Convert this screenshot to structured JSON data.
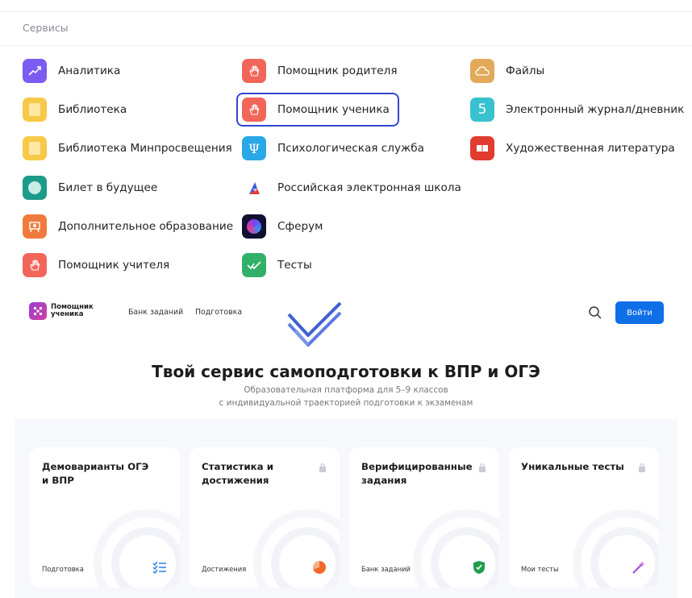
{
  "services": {
    "title": "Сервисы",
    "columns": [
      [
        {
          "label": "Аналитика",
          "icon": "analytics-icon",
          "color": "#7b5cf0"
        },
        {
          "label": "Библиотека",
          "icon": "book-icon",
          "color": "#f7c948"
        },
        {
          "label": "Библиотека Минпросвещения",
          "icon": "book-icon",
          "color": "#f7c948"
        },
        {
          "label": "Билет в будущее",
          "icon": "ticket-icon",
          "color": "#1d9b8a"
        },
        {
          "label": "Дополнительное образование",
          "icon": "teacher-icon",
          "color": "#f07a3d"
        },
        {
          "label": "Помощник учителя",
          "icon": "hand-icon",
          "color": "#f2665a"
        }
      ],
      [
        {
          "label": "Помощник родителя",
          "icon": "hand-icon",
          "color": "#f2665a"
        },
        {
          "label": "Помощник ученика",
          "icon": "hand-icon",
          "color": "#f2665a",
          "selected": true
        },
        {
          "label": "Психологическая служба",
          "icon": "psi-icon",
          "color": "#2aa7e6"
        },
        {
          "label": "Российская электронная школа",
          "icon": "res-logo-icon",
          "color": "#ffffff"
        },
        {
          "label": "Сферум",
          "icon": "sferum-icon",
          "color": "#101030"
        },
        {
          "label": "Тесты",
          "icon": "check-icon",
          "color": "#32b06a"
        }
      ],
      [
        {
          "label": "Файлы",
          "icon": "cloud-icon",
          "color": "#e3a95a"
        },
        {
          "label": "Электронный журнал/дневник",
          "icon": "five-icon",
          "color": "#39c1cf",
          "glyph": "5"
        },
        {
          "label": "Художественная литература",
          "icon": "open-book-icon",
          "color": "#e23b2f"
        }
      ]
    ]
  },
  "site": {
    "logo_text": "Помощник ученика",
    "nav": [
      "Банк заданий",
      "Подготовка"
    ],
    "login_label": "Войти",
    "hero_title": "Твой сервис самоподготовки к ВПР и ОГЭ",
    "hero_sub_1": "Образовательная платформа для 5–9 классов",
    "hero_sub_2": "с индивидуальной траекторией подготовки к экзаменам",
    "cards": [
      {
        "title": "Демоварианты ОГЭ и ВПР",
        "footer": "Подготовка",
        "icon": "checklist-icon",
        "locked": false
      },
      {
        "title": "Статистика и достижения",
        "footer": "Достижения",
        "icon": "pie-icon",
        "locked": true
      },
      {
        "title": "Верифицированные задания",
        "footer": "Банк заданий",
        "icon": "shield-check-icon",
        "locked": true
      },
      {
        "title": "Уникальные тесты",
        "footer": "Мои тесты",
        "icon": "magic-wand-icon",
        "locked": true
      }
    ]
  }
}
